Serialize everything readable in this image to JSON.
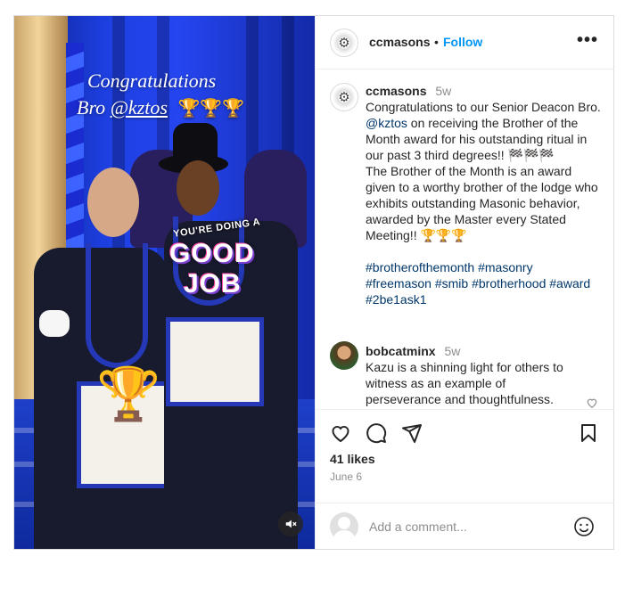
{
  "media": {
    "caption_line1": "Congratulations",
    "caption_prefix": "Bro",
    "caption_handle": "@kztos",
    "caption_trophies": "🏆🏆🏆",
    "sticker_small": "YOU'RE DOING A",
    "sticker_good": "GOOD",
    "sticker_job": "JOB",
    "trophy": "🏆"
  },
  "header": {
    "username": "ccmasons",
    "dot": "•",
    "follow": "Follow"
  },
  "caption": {
    "username": "ccmasons",
    "time": "5w",
    "text_1": "Congratulations to our Senior Deacon Bro. ",
    "mention": "@kztos",
    "text_2": " on receiving the Brother of the Month award for his outstanding ritual in our past 3 third degrees!! 🏁🏁🏁",
    "text_3": "The Brother of the Month is an award given to a worthy brother of the lodge who exhibits outstanding Masonic behavior, awarded by the Master every Stated Meeting!! 🏆🏆🏆",
    "hashtags": [
      "#brotherofthemonth",
      "#masonry",
      "#freemason",
      "#smib",
      "#brotherhood",
      "#award",
      "#2be1ask1"
    ]
  },
  "comment": {
    "username": "bobcatminx",
    "time": "5w",
    "text": "Kazu is a shinning light for others to witness as an example of perseverance and thoughtfulness."
  },
  "stats": {
    "likes": "41 likes",
    "date": "June 6"
  },
  "add_comment": {
    "placeholder": "Add a comment..."
  }
}
